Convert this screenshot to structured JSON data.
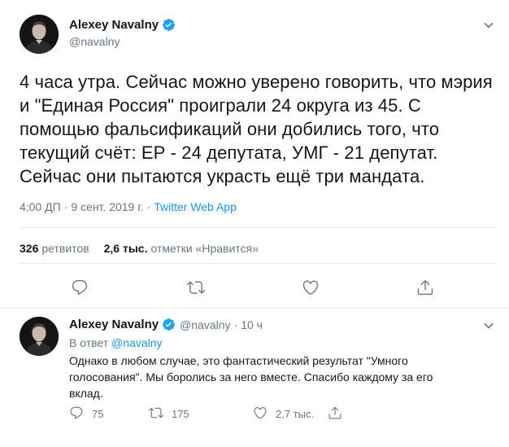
{
  "main_tweet": {
    "author": {
      "name": "Alexey Navalny",
      "handle": "@navalny"
    },
    "text": "4 часа утра. Сейчас можно уверено говорить, что мэрия и \"Единая Россия\" проиграли 24 округа из 45. С помощью фальсификаций они добились того, что текущий счёт: ЕР - 24 депутата, УМГ - 21 депутат. Сейчас они пытаются украсть ещё три мандата.",
    "time": "4:00 ДП",
    "date": "9 сент. 2019 г.",
    "dot": "·",
    "source": "Twitter Web App",
    "retweets_count": "326",
    "retweets_label": "ретвитов",
    "likes_count": "2,6 тыс.",
    "likes_label": "отметки «Нравится»",
    "icons": [
      "reply-icon",
      "retweet-icon",
      "like-icon",
      "share-icon"
    ]
  },
  "reply_tweet": {
    "author": {
      "name": "Alexey Navalny",
      "handle": "@navalny"
    },
    "time_ago": "10 ч",
    "dot": "·",
    "in_reply_prefix": "В ответ",
    "in_reply_mention": "@navalny",
    "text": "Однако в любом случае, это фантастический результат \"Умного голосования\". Мы боролись за него вместе. Спасибо каждому за его вклад.",
    "reply_count": "75",
    "retweet_count": "175",
    "like_count": "2,7 тыс."
  },
  "colors": {
    "text": "#14171a",
    "secondary": "#657786",
    "link": "#1b95e0",
    "verified": "#1da1f2",
    "divider": "#e6ecf0"
  }
}
